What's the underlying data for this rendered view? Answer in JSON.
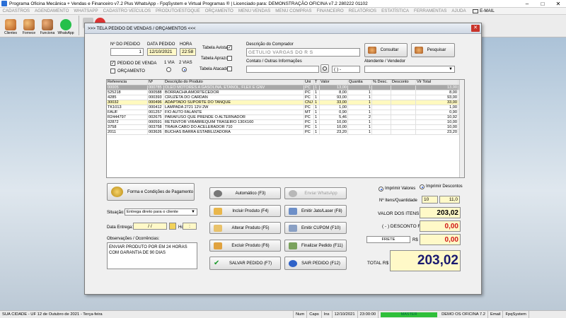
{
  "window": {
    "title": "Programa Oficina Mecânica + Vendas e Financeiro v7.2 Plus WhatsApp - FpqSystem e Virtual Programas ® | Licenciado para: DEMONSTRAÇÃO OFICINA v7.2 280222 01102"
  },
  "menu": [
    "CADASTROS",
    "AGENDAMENTO",
    "WHATSAPP",
    "CADASTRO VEÍCULOS",
    "PRODUTO/ESTOQUE",
    "ORÇAMENTO",
    "MENU VENDAS",
    "MENU COMPRAS",
    "FINANCEIRO",
    "RELATÓRIOS",
    "ESTATÍSTICA",
    "FERRAMENTAS",
    "AJUDA"
  ],
  "menu_email": "E-MAIL",
  "toolbar": {
    "clientes": "Clientes",
    "fornecedores": "Fornece",
    "funcionarios": "Funciona",
    "whatsapp": "WhatsApp"
  },
  "dialog": {
    "title": ">>>  TELA PEDIDO DE VENDAS / ORÇAMENTOS  <<<",
    "labels": {
      "pedido_no": "Nº DO PEDIDO",
      "data_pedido": "DATA PEDIDO",
      "hora": "HORA",
      "tabela_avista": "Tabela Avista",
      "tabela_aprazo": "Tabela Aprazo",
      "tabela_atacado": "Tabela Atacado",
      "pedido_venda": "PEDIDO DE VENDA",
      "orcamento": "ORÇAMENTO",
      "uma_via": "1 VIA",
      "duas_vias": "2 VIAS",
      "descricao_comprador": "Descrição do Comprador",
      "contato": "Contato / Outras Informações",
      "vendedor": "Atendente / Vendedor",
      "consultar": "Consultar",
      "pesquisar": "Pesquisar"
    },
    "values": {
      "pedido_no": "1",
      "data_pedido": "12/10/2021",
      "hora": "22:58",
      "comprador": "GETULIO VARGAS DO R S",
      "phone": "(  )   -"
    }
  },
  "grid": {
    "columns": [
      "Referencia",
      "Nº",
      "Descrição do Produto",
      "Uni",
      "T",
      "Valor",
      "Quantia",
      "% Desc.",
      "Desconto",
      "Vlr Total"
    ],
    "rows": [
      {
        "ref": "00005",
        "num": "000785",
        "desc": "ÓLEO MOTORES A GASOLINA, ETANOL, FLEX E GNV",
        "uni": "PC",
        "t": "1",
        "valor": "13,00",
        "quantia": "1",
        "pdesc": "",
        "desconto": "",
        "total": "13,00"
      },
      {
        "ref": "525218",
        "num": "000588",
        "desc": "BORRACHA AMORTECEDOR",
        "uni": "PC",
        "t": "1",
        "valor": "8,00",
        "quantia": "1",
        "pdesc": "",
        "desconto": "",
        "total": "8,00"
      },
      {
        "ref": "4285",
        "num": "000393",
        "desc": "CRUZETA DO CARDAN",
        "uni": "PC",
        "t": "1",
        "valor": "93,00",
        "quantia": "1",
        "pdesc": "",
        "desconto": "",
        "total": "93,00"
      },
      {
        "ref": "30032",
        "num": "000496",
        "desc": "ADAPTADO SUPORTE DO TANQUE",
        "uni": "CNJ",
        "t": "1",
        "valor": "33,00",
        "quantia": "1",
        "pdesc": "",
        "desconto": "",
        "total": "33,00"
      },
      {
        "ref": "TK1013",
        "num": "000412",
        "desc": "LAMPADA 2721 12V-2W",
        "uni": "PC",
        "t": "1",
        "valor": "1,00",
        "quantia": "1",
        "pdesc": "",
        "desconto": "",
        "total": "1,00"
      },
      {
        "ref": "FAUF",
        "num": "001257",
        "desc": "FIO AUTO FALANTE",
        "uni": "MT",
        "t": "1",
        "valor": "0,90",
        "quantia": "1",
        "pdesc": "",
        "desconto": "",
        "total": "0,90"
      },
      {
        "ref": "R2444797",
        "num": "002675",
        "desc": "PARAFUSO QUE PRENDE O ALTERNADOR",
        "uni": "PC",
        "t": "1",
        "valor": "5,46",
        "quantia": "2",
        "pdesc": "",
        "desconto": "",
        "total": "10,92"
      },
      {
        "ref": "02872",
        "num": "000591",
        "desc": "RETENTOR VIRABREQUIM TRASEIRO 130X160",
        "uni": "PC",
        "t": "1",
        "valor": "10,00",
        "quantia": "1",
        "pdesc": "",
        "desconto": "",
        "total": "10,00"
      },
      {
        "ref": "3758",
        "num": "003758",
        "desc": "TRAVA CABO DO ACELERADOR 710",
        "uni": "PC",
        "t": "1",
        "valor": "10,00",
        "quantia": "1",
        "pdesc": "",
        "desconto": "",
        "total": "10,00"
      },
      {
        "ref": "2011",
        "num": "003626",
        "desc": "BUCHAS BARRA ESTABILIZADORA",
        "uni": "PC",
        "t": "1",
        "valor": "23,20",
        "quantia": "1",
        "pdesc": "",
        "desconto": "",
        "total": "23,20"
      }
    ]
  },
  "bottom": {
    "forma_pagamento": "Forma e Condições de Pagamento",
    "situacao_label": "Situação:",
    "situacao_value": "Entrega direto para o cliente",
    "data_entrega_label": "Data Entrega:",
    "data_entrega_value": "/  /",
    "hora_label": "Hora:",
    "hora_value": ":",
    "obs_label": "Observações / Ocorrências:",
    "obs_value": "ENVIAR PRODUTO POR EM 24 HORAS COM GARANTIA DE 90 DIAS",
    "btn_automatico": "Automático     (F3)",
    "btn_whatsapp": "Enviar WhatsApp",
    "btn_incluir": "Incluir Produto  (F4)",
    "btn_jato": "Emitir Jato/Laser (F8)",
    "btn_alterar": "Alterar Produto  (F5)",
    "btn_cupom": "Emitir CUPOM   (F10)",
    "btn_excluir": "Excluir Produto  (F6)",
    "btn_finalizar": "Finalizar Pedido  (F11)",
    "btn_salvar": "SALVAR PEDIDO (F7)",
    "btn_sair": "SAIR  PEDIDO  (F12)"
  },
  "totals": {
    "imprimir_valores": "Imprimir Valores",
    "imprimir_descontos": "Imprimir Descontos",
    "itens_label": "Nº Itens/Quantidade",
    "itens_value": "10",
    "quantidade_value": "11,0",
    "valor_itens_label": "VALOR DOS ITENS R$",
    "valor_itens_value": "203,02",
    "desconto_label": "( - ) DESCONTO R$",
    "desconto_value": "0,00",
    "frete_label": "FRETE",
    "frete_currency": "R$",
    "frete_value": "0,00",
    "total_label": "TOTAL R$",
    "total_value": "203,02"
  },
  "statusbar": {
    "cidade": "SUA CIDADE - UF  12 de Outubro de 2021 - Terça-feira",
    "num": "Num",
    "caps": "Caps",
    "ins": "Ins",
    "date": "12/10/2021",
    "time": "23:00:00",
    "master": "MASTER",
    "demo": "DEMO OS OFICINA 7.2",
    "email": "Email",
    "fpq": "FpqSystem"
  }
}
